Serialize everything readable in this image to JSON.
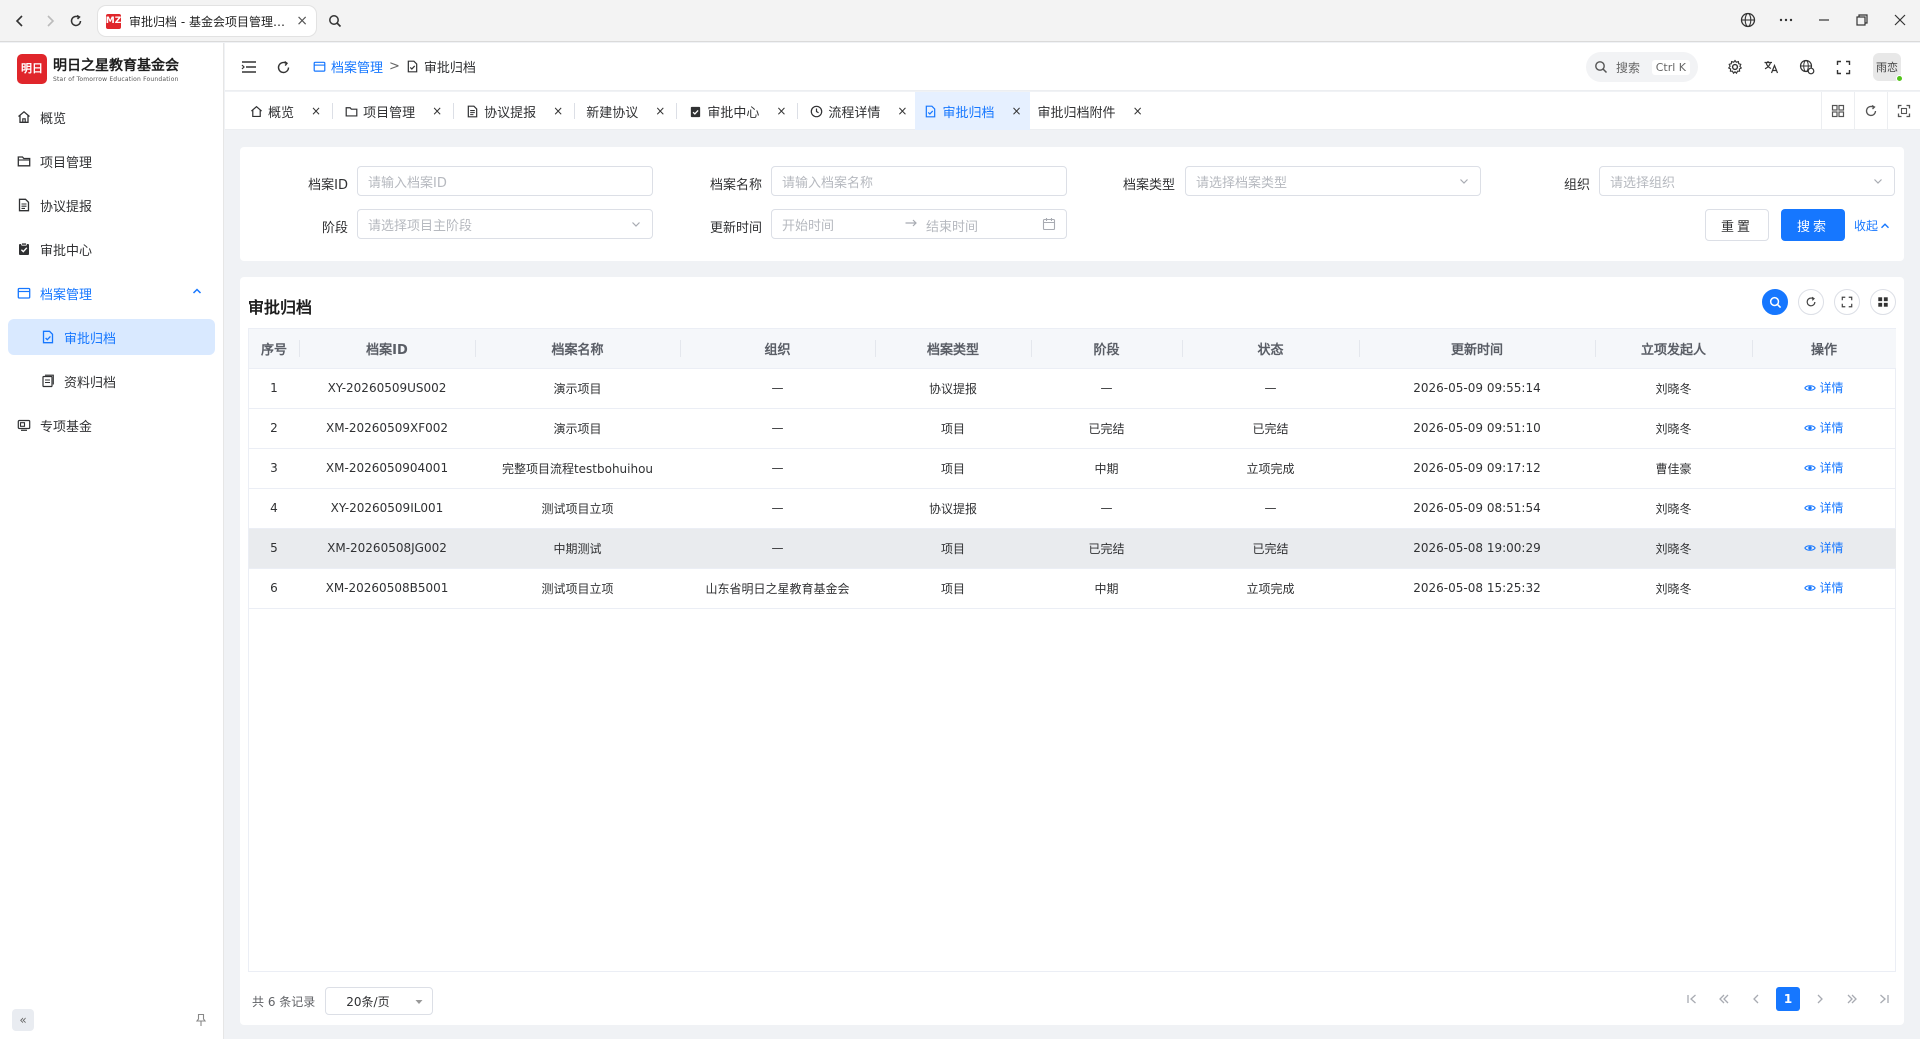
{
  "browser": {
    "tab_title": "审批归档 - 基金会项目管理系统",
    "tab_close": "×",
    "favicon_text": "MZ",
    "window_controls": [
      "globe-icon",
      "more-icon",
      "minimize-icon",
      "restore-icon",
      "close-icon"
    ]
  },
  "sidebar": {
    "logo_mark": "明日",
    "logo_cn": "明日之星教育基金会",
    "logo_en": "Star of Tomorrow Education Foundation",
    "items": [
      {
        "label": "概览",
        "icon": "home-icon"
      },
      {
        "label": "项目管理",
        "icon": "folder-icon"
      },
      {
        "label": "协议提报",
        "icon": "document-icon"
      },
      {
        "label": "审批中心",
        "icon": "clipboard-check-icon"
      },
      {
        "label": "档案管理",
        "icon": "archive-icon"
      },
      {
        "label": "审批归档",
        "icon": "file-check-icon"
      },
      {
        "label": "资料归档",
        "icon": "files-icon"
      },
      {
        "label": "专项基金",
        "icon": "fund-icon"
      }
    ],
    "collapse_glyph": "«",
    "pin_icon": "pin-icon"
  },
  "header": {
    "breadcrumb_parent": "档案管理",
    "breadcrumb_sep": ">",
    "breadcrumb_current": "审批归档",
    "search_placeholder": "搜索",
    "search_shortcut": "Ctrl K",
    "user_name": "雨恋"
  },
  "tabs": [
    {
      "label": "概览",
      "icon": "home-icon",
      "close": "×"
    },
    {
      "label": "项目管理",
      "icon": "folder-icon",
      "close": "×"
    },
    {
      "label": "协议提报",
      "icon": "document-icon",
      "close": "×"
    },
    {
      "label": "新建协议",
      "icon": "",
      "close": "×"
    },
    {
      "label": "审批中心",
      "icon": "clipboard-check-icon",
      "close": "×"
    },
    {
      "label": "流程详情",
      "icon": "clock-icon",
      "close": "×"
    },
    {
      "label": "审批归档",
      "icon": "file-check-icon",
      "close": "×"
    },
    {
      "label": "审批归档附件",
      "icon": "",
      "close": "×"
    }
  ],
  "filters": {
    "archive_id_label": "档案ID",
    "archive_id_placeholder": "请输入档案ID",
    "archive_name_label": "档案名称",
    "archive_name_placeholder": "请输入档案名称",
    "archive_type_label": "档案类型",
    "archive_type_placeholder": "请选择档案类型",
    "org_label": "组织",
    "org_placeholder": "请选择组织",
    "stage_label": "阶段",
    "stage_placeholder": "请选择项目主阶段",
    "update_time_label": "更新时间",
    "start_placeholder": "开始时间",
    "end_placeholder": "结束时间",
    "reset_label": "重置",
    "search_label": "搜索",
    "collapse_label": "收起"
  },
  "table": {
    "title": "审批归档",
    "columns": [
      "序号",
      "档案ID",
      "档案名称",
      "组织",
      "档案类型",
      "阶段",
      "状态",
      "更新时间",
      "立项发起人",
      "操作"
    ],
    "action_label": "详情",
    "rows": [
      [
        "1",
        "XY-20260509US002",
        "演示项目",
        "—",
        "协议提报",
        "—",
        "—",
        "2026-05-09 09:55:14",
        "刘晓冬"
      ],
      [
        "2",
        "XM-20260509XF002",
        "演示项目",
        "—",
        "项目",
        "已完结",
        "已完结",
        "2026-05-09 09:51:10",
        "刘晓冬"
      ],
      [
        "3",
        "XM-2026050904001",
        "完整项目流程testbohuihou",
        "—",
        "项目",
        "中期",
        "立项完成",
        "2026-05-09 09:17:12",
        "曹佳豪"
      ],
      [
        "4",
        "XY-20260509IL001",
        "测试项目立项",
        "—",
        "协议提报",
        "—",
        "—",
        "2026-05-09 08:51:54",
        "刘晓冬"
      ],
      [
        "5",
        "XM-20260508JG002",
        "中期测试",
        "—",
        "项目",
        "已完结",
        "已完结",
        "2026-05-08 19:00:29",
        "刘晓冬"
      ],
      [
        "6",
        "XM-20260508B5001",
        "测试项目立项",
        "山东省明日之星教育基金会",
        "项目",
        "中期",
        "立项完成",
        "2026-05-08 15:25:32",
        "刘晓冬"
      ]
    ],
    "highlighted_row": 5
  },
  "pagination": {
    "total_text": "共 6 条记录",
    "page_size": "20条/页",
    "current_page": "1"
  },
  "colors": {
    "accent": "#1677ff",
    "brand_red": "#e0262b",
    "row_highlight": "#e9ebee"
  }
}
